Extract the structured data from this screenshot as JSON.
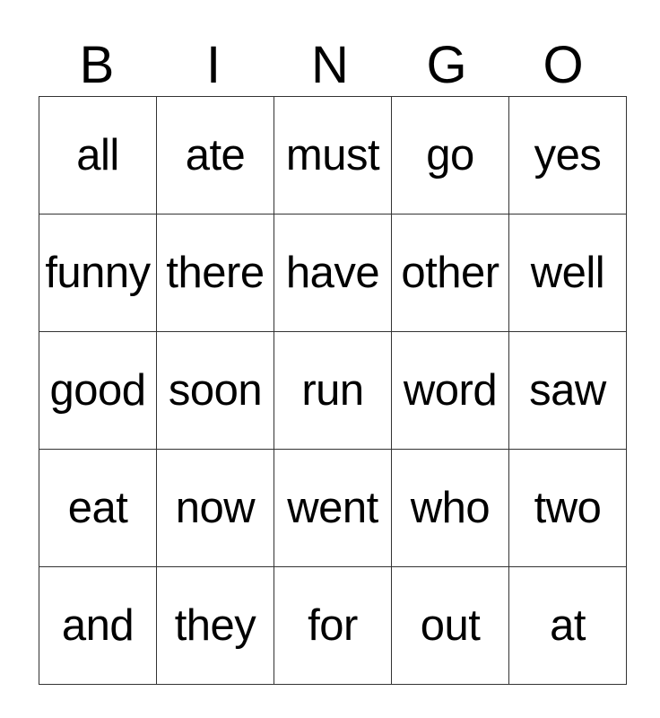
{
  "header": [
    "B",
    "I",
    "N",
    "G",
    "O"
  ],
  "rows": [
    [
      "all",
      "ate",
      "must",
      "go",
      "yes"
    ],
    [
      "funny",
      "there",
      "have",
      "other",
      "well"
    ],
    [
      "good",
      "soon",
      "run",
      "word",
      "saw"
    ],
    [
      "eat",
      "now",
      "went",
      "who",
      "two"
    ],
    [
      "and",
      "they",
      "for",
      "out",
      "at"
    ]
  ]
}
